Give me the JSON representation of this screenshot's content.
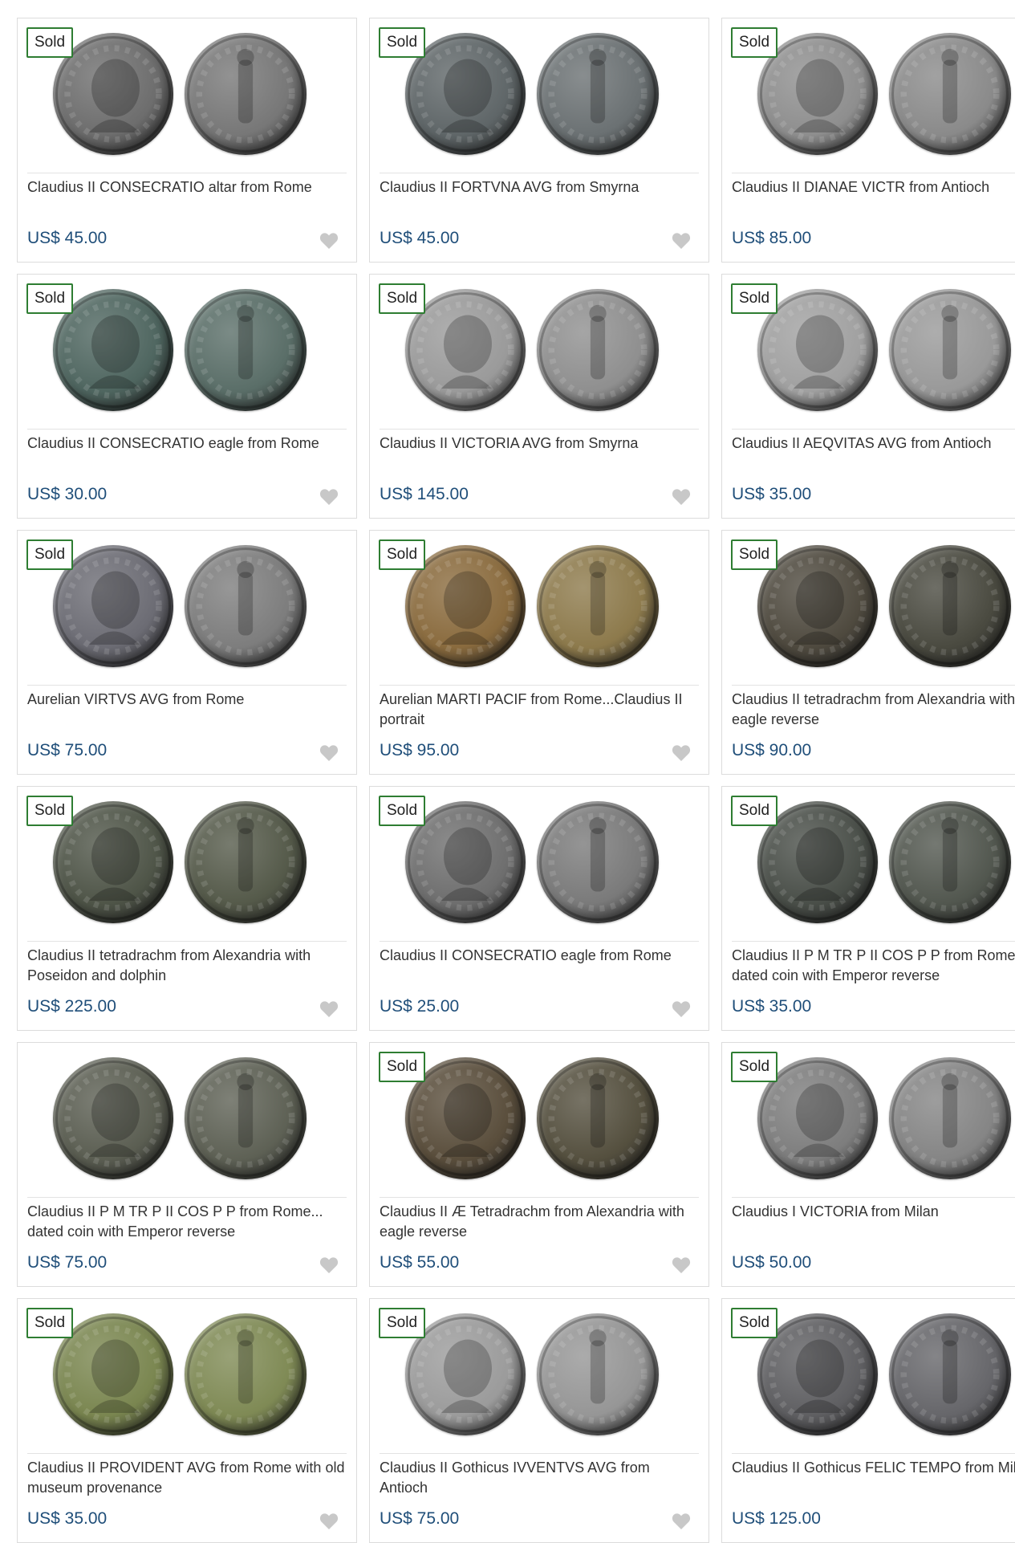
{
  "listing": {
    "items": [
      {
        "title": "Claudius II CONSECRATIO altar from Rome",
        "price": "US$ 45.00",
        "badge": "Sold",
        "coin_colors": [
          "#6d6d6d",
          "#777777"
        ]
      },
      {
        "title": "Claudius II FORTVNA AVG from Smyrna",
        "price": "US$ 45.00",
        "badge": "Sold",
        "coin_colors": [
          "#5f6668",
          "#6b7173"
        ]
      },
      {
        "title": "Claudius II DIANAE VICTR from Antioch",
        "price": "US$ 85.00",
        "badge": "Sold",
        "coin_colors": [
          "#8e8e8e",
          "#8a8a8a"
        ]
      },
      {
        "title": "Claudius II CONSECRATIO eagle from Rome",
        "price": "US$ 30.00",
        "badge": "Sold",
        "coin_colors": [
          "#4f6660",
          "#5a6e68"
        ]
      },
      {
        "title": "Claudius II VICTORIA AVG from Smyrna",
        "price": "US$ 145.00",
        "badge": "Sold",
        "coin_colors": [
          "#9a9a9a",
          "#8f8f8f"
        ]
      },
      {
        "title": "Claudius II AEQVITAS AVG from Antioch",
        "price": "US$ 35.00",
        "badge": "Sold",
        "coin_colors": [
          "#a0a0a0",
          "#999999"
        ]
      },
      {
        "title": "Aurelian VIRTVS AVG from Rome",
        "price": "US$ 75.00",
        "badge": "Sold",
        "coin_colors": [
          "#6c6c74",
          "#7d7d7d"
        ]
      },
      {
        "title": "Aurelian MARTI PACIF from Rome...Claudius II portrait",
        "price": "US$ 95.00",
        "badge": "Sold",
        "coin_colors": [
          "#8a6b3e",
          "#8d7a4c"
        ]
      },
      {
        "title": "Claudius II tetradrachm from Alexandria with eagle reverse",
        "price": "US$ 90.00",
        "badge": "Sold",
        "coin_colors": [
          "#4f4a3f",
          "#4a4a40"
        ]
      },
      {
        "title": "Claudius II tetradrachm from Alexandria with Poseidon and dolphin",
        "price": "US$ 225.00",
        "badge": "Sold",
        "coin_colors": [
          "#4f5548",
          "#555a4a"
        ]
      },
      {
        "title": "Claudius II CONSECRATIO eagle from Rome",
        "price": "US$ 25.00",
        "badge": "Sold",
        "coin_colors": [
          "#6e6e6e",
          "#7a7a7a"
        ]
      },
      {
        "title": "Claudius II P M TR P II COS P P from Rome... dated coin with Emperor reverse",
        "price": "US$ 35.00",
        "badge": "Sold",
        "coin_colors": [
          "#4a4f49",
          "#52574f"
        ]
      },
      {
        "title": "Claudius II P M TR P II COS P P from Rome... dated coin with Emperor reverse",
        "price": "US$ 75.00",
        "badge": "",
        "coin_colors": [
          "#5b5e52",
          "#5e6155"
        ]
      },
      {
        "title": "Claudius II Æ Tetradrachm from Alexandria with eagle reverse",
        "price": "US$ 55.00",
        "badge": "Sold",
        "coin_colors": [
          "#5a4e3c",
          "#55503f"
        ]
      },
      {
        "title": "Claudius I VICTORIA from Milan",
        "price": "US$ 50.00",
        "badge": "Sold",
        "coin_colors": [
          "#7d7d7d",
          "#858585"
        ]
      },
      {
        "title": "Claudius II PROVIDENT AVG from Rome with old museum provenance",
        "price": "US$ 35.00",
        "badge": "Sold",
        "coin_colors": [
          "#7a8650",
          "#7f8a55"
        ]
      },
      {
        "title": "Claudius II Gothicus IVVENTVS AVG from Antioch",
        "price": "US$ 75.00",
        "badge": "Sold",
        "coin_colors": [
          "#9b9b9b",
          "#969696"
        ]
      },
      {
        "title": "Claudius II Gothicus FELIC TEMPO from Milan",
        "price": "US$ 125.00",
        "badge": "Sold",
        "coin_colors": [
          "#5f5f62",
          "#66666a"
        ]
      }
    ]
  },
  "icons": {
    "favorite": "heart-icon"
  },
  "colors": {
    "price": "#1f4e79",
    "sold_border": "#2e7d32",
    "heart": "#c8c8c8"
  }
}
